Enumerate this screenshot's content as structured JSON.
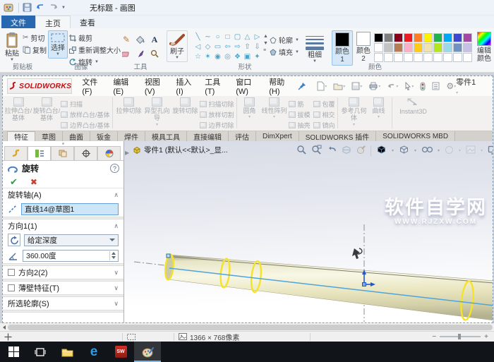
{
  "paint": {
    "title": "无标题 - 画图",
    "tabs": {
      "file": "文件",
      "home": "主页",
      "view": "查看"
    },
    "clipboard": {
      "paste": "粘贴",
      "cut": "剪切",
      "copy": "复制",
      "label": "剪贴板"
    },
    "image": {
      "select": "选择",
      "crop": "裁剪",
      "resize": "重新调整大小",
      "rotate": "旋转",
      "label": "图像"
    },
    "tools": {
      "label": "工具",
      "text_tool": "A"
    },
    "brushes": {
      "label": "刷子"
    },
    "shapes": {
      "label": "形状",
      "outline": "轮廓",
      "fill": "填充",
      "glyphs": [
        "╲",
        "∼",
        "○",
        "□",
        "▢",
        "△",
        "▷",
        "◁",
        "◇",
        "▭",
        "⇦",
        "⇨",
        "⇧",
        "⇩",
        "☆",
        "✶",
        "◉",
        "◎",
        "❖",
        "▣",
        "✦"
      ]
    },
    "size": {
      "label": "粗细"
    },
    "colors": {
      "label": "颜色",
      "color1": "颜色1",
      "color2": "颜色2",
      "edit": "编辑颜色",
      "color1_value": "#000000",
      "color2_value": "#ffffff",
      "row1": [
        "#000000",
        "#7f7f7f",
        "#88001b",
        "#ec1c24",
        "#ff7f27",
        "#fff200",
        "#23b14d",
        "#00a8f3",
        "#3f48cc",
        "#a349a4"
      ],
      "row2": [
        "#ffffff",
        "#c3c3c3",
        "#b97a56",
        "#ffaec8",
        "#ffca18",
        "#efe4b0",
        "#b5e61d",
        "#99d9ea",
        "#7092be",
        "#c8bfe7"
      ]
    },
    "statusbar": {
      "image_size": "1366 × 768像素"
    }
  },
  "solidworks": {
    "brand": {
      "name": "SOLIDWORKS"
    },
    "menus": [
      "文件(F)",
      "编辑(E)",
      "视图(V)",
      "插入(I)",
      "工具(T)",
      "窗口(W)",
      "帮助(H)"
    ],
    "doc_button": "零件1",
    "cmd": {
      "extrude": "拉伸凸台/基体",
      "revolve": "旋转凸台/基体",
      "sweep": "扫描",
      "loft": "放样凸台/基体",
      "boundary": "边界凸台/基体",
      "cut_extrude": "拉伸切除",
      "hole_wizard": "异型孔向导",
      "cut_revolve": "旋转切除",
      "cut_sweep": "扫描切除",
      "cut_loft": "放样切割",
      "cut_boundary": "边界切除",
      "fillet": "圆角",
      "pattern": "线性阵列",
      "rib": "筋",
      "draft": "拔模",
      "shell": "抽壳",
      "wrap": "包覆",
      "intersect": "相交",
      "mirror": "镜向",
      "ref_geo": "参考几何体",
      "curves": "曲线",
      "instant3d": "Instant3D"
    },
    "tabs": [
      "特征",
      "草图",
      "曲面",
      "钣金",
      "焊件",
      "模具工具",
      "直接编辑",
      "评估",
      "DimXpert",
      "SOLIDWORKS 插件",
      "SOLIDWORKS MBD"
    ],
    "pm": {
      "title": "旋转",
      "help": "?",
      "axis_label": "旋转轴(A)",
      "axis_value": "直线14@草图1",
      "dir1_label": "方向1(1)",
      "end_condition": "给定深度",
      "angle": "360.00度",
      "dir2_label": "方向2(2)",
      "thin_label": "薄壁特征(T)",
      "contours_label": "所选轮廓(S)"
    },
    "tree_item": "零件1 (默认<<默认>_显...",
    "watermark": {
      "line1": "软件自学网",
      "line2": "WWW.RJZXW.COM"
    },
    "accent_colors": {
      "highlight_yellow": "#f5e32a",
      "edge_blue": "#4da4dd",
      "shaft_fill": "#ece9c6"
    }
  },
  "taskbar": {
    "edge_glyph": "e",
    "sw_label": "SW"
  }
}
